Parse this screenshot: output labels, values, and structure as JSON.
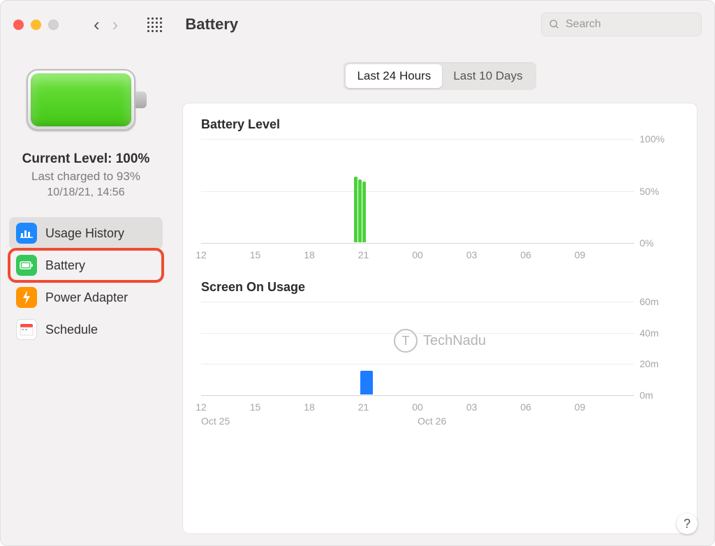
{
  "toolbar": {
    "title": "Battery",
    "search_placeholder": "Search"
  },
  "sidebar": {
    "current_level_label": "Current Level: 100%",
    "last_charged": "Last charged to 93%",
    "timestamp": "10/18/21, 14:56",
    "items": [
      {
        "label": "Usage History"
      },
      {
        "label": "Battery"
      },
      {
        "label": "Power Adapter"
      },
      {
        "label": "Schedule"
      }
    ]
  },
  "tabs": {
    "t24": "Last 24 Hours",
    "t10d": "Last 10 Days"
  },
  "watermark": "TechNadu",
  "chart_data": [
    {
      "type": "bar",
      "title": "Battery Level",
      "x_ticks": [
        "12",
        "15",
        "18",
        "21",
        "00",
        "03",
        "06",
        "09"
      ],
      "ylabels": [
        "100%",
        "50%",
        "0%"
      ],
      "ylim": [
        0,
        100
      ],
      "series": [
        {
          "name": "Battery Level",
          "color": "#4cd13d",
          "values": [
            {
              "hour": 20.5,
              "value": 63
            },
            {
              "hour": 20.7,
              "value": 60
            },
            {
              "hour": 20.9,
              "value": 58
            }
          ]
        }
      ]
    },
    {
      "type": "bar",
      "title": "Screen On Usage",
      "x_ticks": [
        "12",
        "15",
        "18",
        "21",
        "00",
        "03",
        "06",
        "09"
      ],
      "date_labels": [
        {
          "at": "12",
          "text": "Oct 25"
        },
        {
          "at": "00",
          "text": "Oct 26"
        }
      ],
      "ylabels": [
        "60m",
        "40m",
        "20m",
        "0m"
      ],
      "ylim": [
        0,
        60
      ],
      "series": [
        {
          "name": "Screen On",
          "color": "#1d7cff",
          "values": [
            {
              "hour": 21,
              "value": 15
            }
          ]
        }
      ]
    }
  ],
  "help": "?"
}
